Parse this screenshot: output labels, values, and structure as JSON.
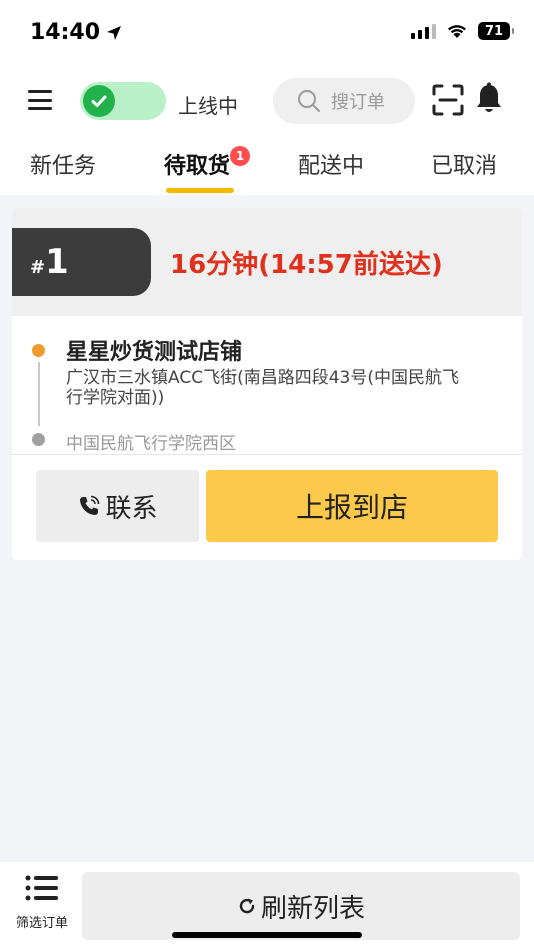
{
  "status_bar": {
    "time": "14:40",
    "battery": "71"
  },
  "toolbar": {
    "online_label": "上线中",
    "search_placeholder": "搜订单"
  },
  "tabs": [
    {
      "label": "新任务"
    },
    {
      "label": "待取货",
      "badge": "1"
    },
    {
      "label": "配送中"
    },
    {
      "label": "已取消"
    }
  ],
  "order": {
    "hash": "#",
    "number": "1",
    "eta": "16分钟(14:57前送达)",
    "shop_name": "星星炒货测试店铺",
    "shop_address": "广汉市三水镇ACC飞街(南昌路四段43号(中国民航飞行学院对面))",
    "destination": "中国民航飞行学院西区",
    "contact_label": "联系",
    "report_label": "上报到店"
  },
  "bottom": {
    "filter_label": "筛选订单",
    "refresh_label": "刷新列表"
  },
  "colors": {
    "accent_yellow": "#fdc94a",
    "tab_underline": "#f5b800",
    "eta_red": "#e0301e",
    "online_green": "#22b24c"
  }
}
